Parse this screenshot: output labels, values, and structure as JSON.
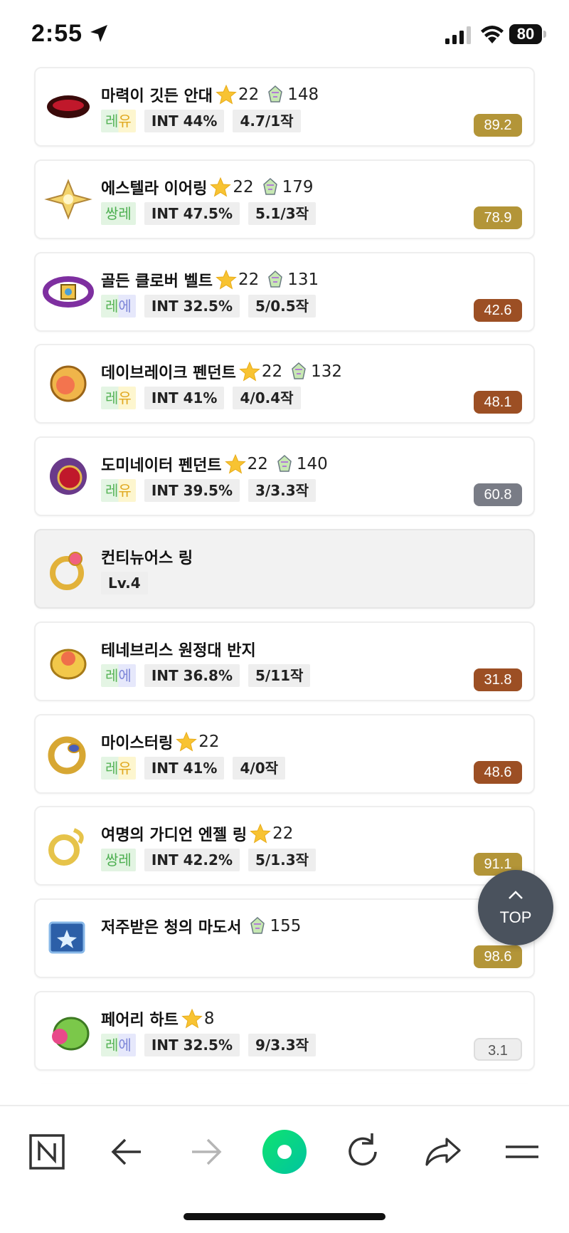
{
  "status_bar": {
    "time": "2:55",
    "battery": "80"
  },
  "items": [
    {
      "name": "마력이 깃든 안대",
      "star": "22",
      "gem": "148",
      "grade": [
        "레",
        "유"
      ],
      "grade_type": "reyu",
      "tags": [
        "INT 44%",
        "4.7/1작"
      ],
      "score": "89.2",
      "score_color": "#b39538"
    },
    {
      "name": "에스텔라 이어링",
      "star": "22",
      "gem": "179",
      "grade": [
        "쌍",
        "레"
      ],
      "grade_type": "ssang",
      "tags": [
        "INT 47.5%",
        "5.1/3작"
      ],
      "score": "78.9",
      "score_color": "#b39538"
    },
    {
      "name": "골든 클로버 벨트",
      "star": "22",
      "gem": "131",
      "grade": [
        "레",
        "에"
      ],
      "grade_type": "ree",
      "tags": [
        "INT 32.5%",
        "5/0.5작"
      ],
      "score": "42.6",
      "score_color": "#9c4f24"
    },
    {
      "name": "데이브레이크 펜던트",
      "star": "22",
      "gem": "132",
      "grade": [
        "레",
        "유"
      ],
      "grade_type": "reyu",
      "tags": [
        "INT 41%",
        "4/0.4작"
      ],
      "score": "48.1",
      "score_color": "#9c4f24"
    },
    {
      "name": "도미네이터 펜던트",
      "star": "22",
      "gem": "140",
      "grade": [
        "레",
        "유"
      ],
      "grade_type": "reyu",
      "tags": [
        "INT 39.5%",
        "3/3.3작"
      ],
      "score": "60.8",
      "score_color": "#797c86"
    },
    {
      "name": "컨티뉴어스 링",
      "level": "Lv.4"
    },
    {
      "name": "테네브리스 원정대 반지",
      "grade": [
        "레",
        "에"
      ],
      "grade_type": "ree",
      "tags": [
        "INT 36.8%",
        "5/11작"
      ],
      "score": "31.8",
      "score_color": "#9c4f24"
    },
    {
      "name": "마이스터링",
      "star": "22",
      "grade": [
        "레",
        "유"
      ],
      "grade_type": "reyu",
      "tags": [
        "INT 41%",
        "4/0작"
      ],
      "score": "48.6",
      "score_color": "#9c4f24"
    },
    {
      "name": "여명의 가디언 엔젤 링",
      "star": "22",
      "grade": [
        "쌍",
        "레"
      ],
      "grade_type": "ssang",
      "tags": [
        "INT 42.2%",
        "5/1.3작"
      ],
      "score": "91.1",
      "score_color": "#b39538"
    },
    {
      "name": "저주받은 청의 마도서",
      "gem": "155",
      "score": "98.6",
      "score_color": "#b39538"
    },
    {
      "name": "페어리 하트",
      "star": "8",
      "grade": [
        "레",
        "에"
      ],
      "grade_type": "ree",
      "tags": [
        "INT 32.5%",
        "9/3.3작"
      ],
      "score": "3.1",
      "score_color": "#eeeeee",
      "score_text_color": "#555555"
    }
  ],
  "top_button": {
    "label": "TOP"
  }
}
